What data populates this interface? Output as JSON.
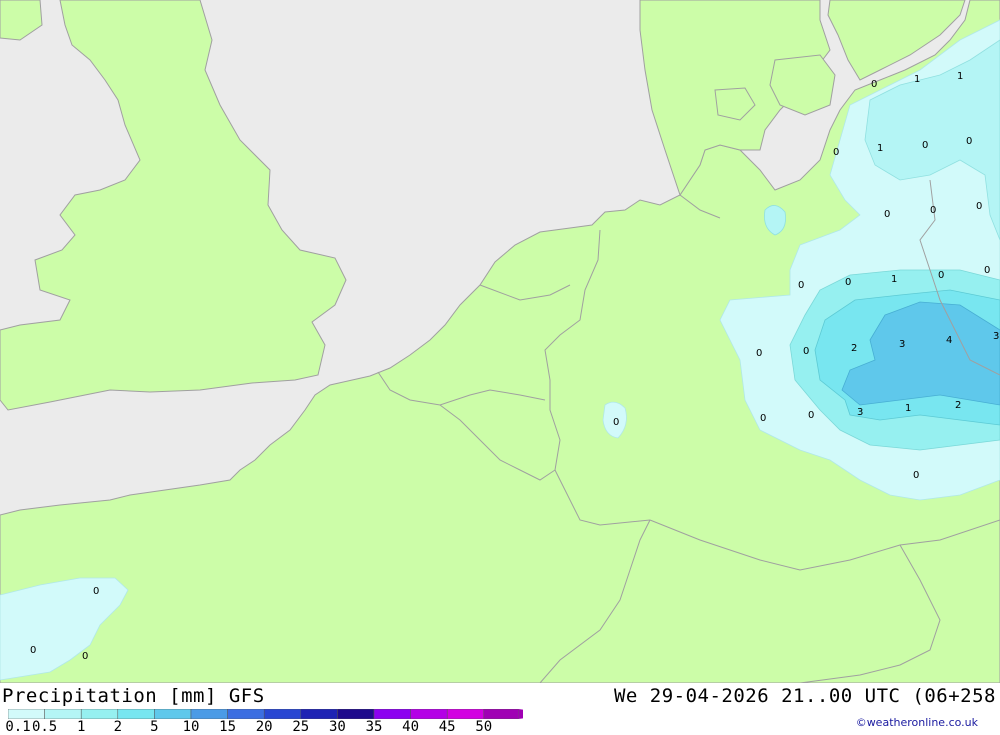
{
  "title": "Precipitation [mm] GFS",
  "valid": "We 29-04-2026 21..00 UTC (06+258",
  "credit": "©weatheronline.co.uk",
  "legend": {
    "ticks": [
      "0.1",
      "0.5",
      "1",
      "2",
      "5",
      "10",
      "15",
      "20",
      "25",
      "30",
      "35",
      "40",
      "45",
      "50"
    ],
    "colors": [
      "#d2fafa",
      "#b4f5f5",
      "#96f0f0",
      "#78e6f0",
      "#5fc8eb",
      "#4b9be6",
      "#3c6ee1",
      "#2846d2",
      "#1e23b4",
      "#1e0a8c",
      "#8c00f0",
      "#b400e6",
      "#d200e1",
      "#a000b4"
    ]
  },
  "palette": {
    "sea": "#ebebeb",
    "land": "#ccfda8",
    "coast": "#a0a0a0"
  },
  "map_labels": [
    {
      "text": "0"
    },
    {
      "text": "1"
    },
    {
      "text": "1"
    },
    {
      "text": "1"
    },
    {
      "text": "0"
    },
    {
      "text": "0"
    },
    {
      "text": "0"
    },
    {
      "text": "0"
    },
    {
      "text": "0"
    },
    {
      "text": "0"
    },
    {
      "text": "0"
    },
    {
      "text": "0"
    },
    {
      "text": "1"
    },
    {
      "text": "0"
    },
    {
      "text": "0"
    },
    {
      "text": "0"
    },
    {
      "text": "0"
    },
    {
      "text": "2"
    },
    {
      "text": "3"
    },
    {
      "text": "4"
    },
    {
      "text": "3"
    },
    {
      "text": "0"
    },
    {
      "text": "0"
    },
    {
      "text": "3"
    },
    {
      "text": "1"
    },
    {
      "text": "2"
    },
    {
      "text": "0"
    },
    {
      "text": "0"
    },
    {
      "text": "0"
    },
    {
      "text": "0"
    },
    {
      "text": "0"
    }
  ]
}
